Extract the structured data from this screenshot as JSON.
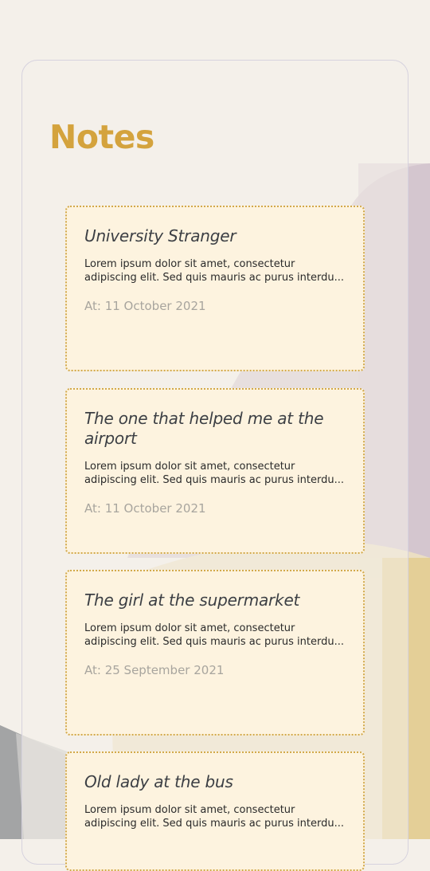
{
  "app": {
    "title": "Notes"
  },
  "notes": [
    {
      "title": "University Stranger",
      "body": "Lorem ipsum dolor sit amet, consectetur adipiscing elit. Sed quis mauris ac purus interdu...",
      "date": "At: 11 October 2021"
    },
    {
      "title": "The one that helped me at the airport",
      "body": "Lorem ipsum dolor sit amet, consectetur adipiscing elit. Sed quis mauris ac purus interdu...",
      "date": "At: 11 October 2021"
    },
    {
      "title": "The girl at the supermarket",
      "body": "Lorem ipsum dolor sit amet, consectetur adipiscing elit. Sed quis mauris ac purus interdu...",
      "date": "At: 25 September 2021"
    },
    {
      "title": "Old lady at the bus",
      "body": "Lorem ipsum dolor sit amet, consectetur adipiscing elit. Sed quis mauris ac purus interdu...",
      "date": ""
    }
  ],
  "colors": {
    "background": "#f4f0ea",
    "accent": "#d4a33d",
    "card": "#fdf3df",
    "card_border": "#d2a94b",
    "lavender_shape": "#d2c3cd",
    "sand_shape": "#e4cf97",
    "gray_shape": "#a3a4a5"
  }
}
